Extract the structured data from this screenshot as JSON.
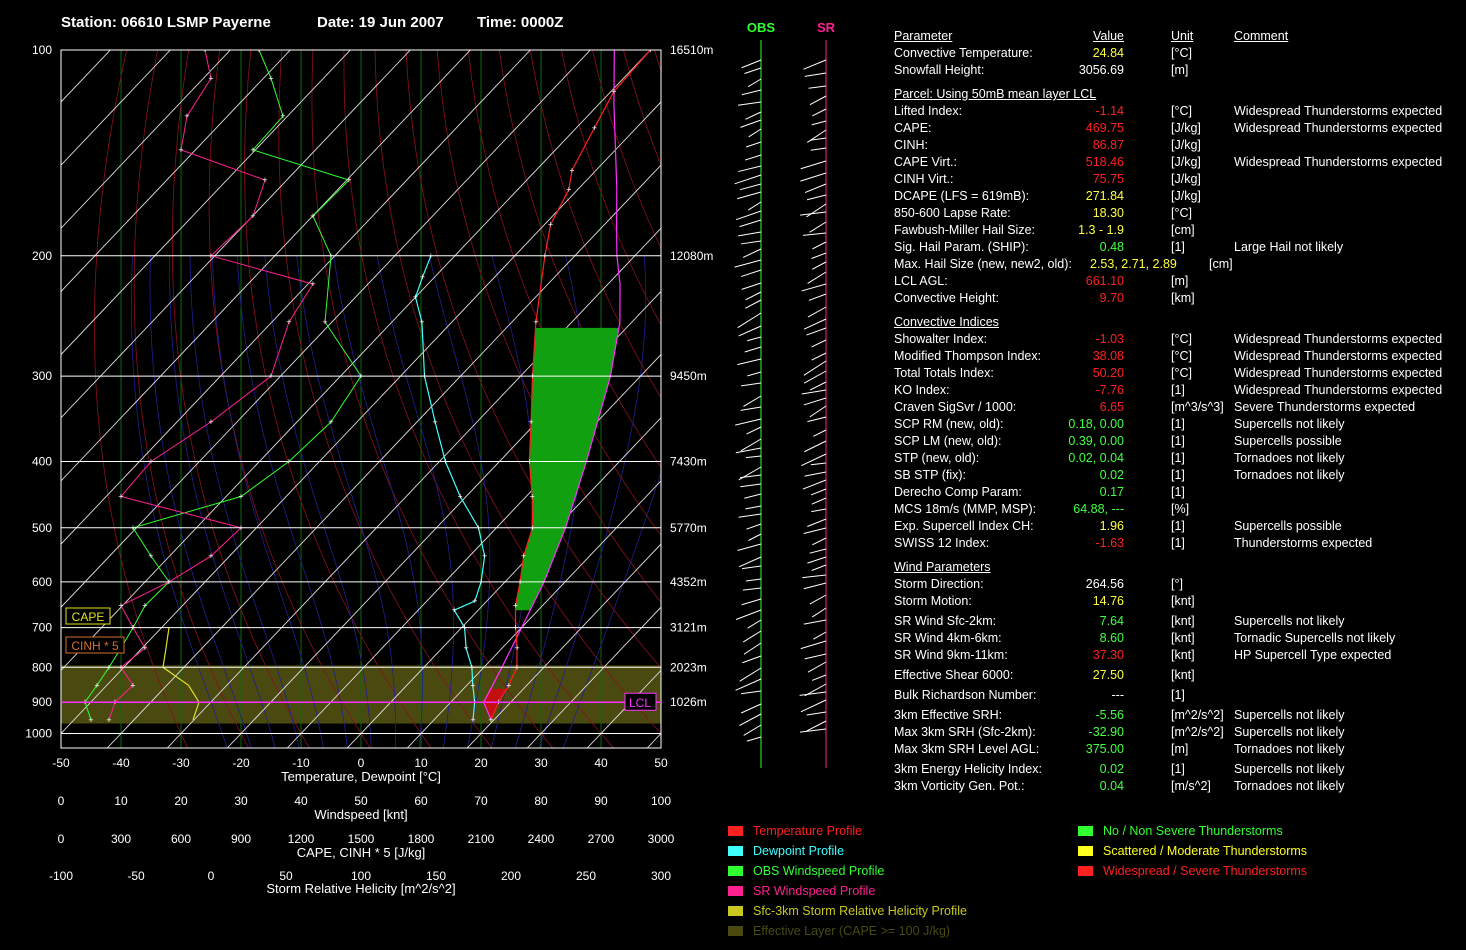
{
  "header": {
    "station": "Station: 06610 LSMP Payerne",
    "date": "Date: 19 Jun 2007",
    "time": "Time: 0000Z"
  },
  "chart_data": {
    "type": "line",
    "title": "Station: 06610 LSMP Payerne   Date: 19 Jun 2007   Time: 0000Z",
    "xlabel": "Temperature, Dewpoint [°C]",
    "ylabel": "",
    "xlim": [
      -50,
      50
    ],
    "ylim": [
      1000,
      100
    ],
    "y_scale": "log-pressure",
    "temperature_ticks": [
      -50,
      -40,
      -30,
      -20,
      -10,
      0,
      10,
      20,
      30,
      40,
      50
    ],
    "pressure_ticks": [
      100,
      200,
      300,
      400,
      500,
      600,
      700,
      800,
      900,
      1000
    ],
    "height_labels": [
      {
        "p": 100,
        "label": "16510m"
      },
      {
        "p": 200,
        "label": "12080m"
      },
      {
        "p": 300,
        "label": "9450m"
      },
      {
        "p": 400,
        "label": "7430m"
      },
      {
        "p": 500,
        "label": "5770m"
      },
      {
        "p": 600,
        "label": "4352m"
      },
      {
        "p": 700,
        "label": "3121m"
      },
      {
        "p": 800,
        "label": "2023m"
      },
      {
        "p": 900,
        "label": "1026m"
      }
    ],
    "series": [
      {
        "name": "Temperature Profile",
        "color": "#ff2020",
        "points": [
          [
            955,
            19.5
          ],
          [
            900,
            18.0
          ],
          [
            850,
            17.0
          ],
          [
            800,
            15.5
          ],
          [
            750,
            12.5
          ],
          [
            700,
            9.0
          ],
          [
            650,
            5.5
          ],
          [
            600,
            2.5
          ],
          [
            550,
            -1.0
          ],
          [
            500,
            -4.0
          ],
          [
            450,
            -9.0
          ],
          [
            400,
            -15.0
          ],
          [
            350,
            -21.0
          ],
          [
            300,
            -28.0
          ],
          [
            250,
            -36.0
          ],
          [
            200,
            -45.0
          ],
          [
            180,
            -49.0
          ],
          [
            160,
            -51.5
          ],
          [
            150,
            -54.0
          ],
          [
            130,
            -57.0
          ],
          [
            115,
            -59.5
          ],
          [
            100,
            -60.0
          ]
        ]
      },
      {
        "name": "Dewpoint Profile",
        "color": "#40ffff",
        "points": [
          [
            955,
            16.5
          ],
          [
            900,
            14.0
          ],
          [
            850,
            11.0
          ],
          [
            800,
            8.0
          ],
          [
            750,
            4.0
          ],
          [
            700,
            0.5
          ],
          [
            660,
            -4.0
          ],
          [
            640,
            -2.0
          ],
          [
            600,
            -4.0
          ],
          [
            550,
            -7.5
          ],
          [
            500,
            -13.0
          ],
          [
            450,
            -21.0
          ],
          [
            400,
            -29.0
          ],
          [
            350,
            -37.0
          ],
          [
            300,
            -46.0
          ],
          [
            250,
            -55.0
          ],
          [
            230,
            -60.0
          ],
          [
            215,
            -62.0
          ],
          [
            200,
            -64.0
          ]
        ]
      },
      {
        "name": "Parcel",
        "color": "#ff30ff",
        "points": [
          [
            955,
            19.5
          ],
          [
            900,
            15.5
          ],
          [
            850,
            14.3
          ],
          [
            800,
            13.0
          ],
          [
            700,
            10.0
          ],
          [
            600,
            6.5
          ],
          [
            500,
            1.5
          ],
          [
            400,
            -5.5
          ],
          [
            300,
            -15.0
          ],
          [
            250,
            -22.0
          ],
          [
            220,
            -28.0
          ],
          [
            200,
            -33.0
          ],
          [
            180,
            -38.0
          ],
          [
            160,
            -43.5
          ],
          [
            140,
            -50.0
          ],
          [
            120,
            -57.5
          ],
          [
            100,
            -66.0
          ]
        ]
      }
    ],
    "obs_windspeed_profile_knots": [
      [
        955,
        5
      ],
      [
        900,
        4
      ],
      [
        850,
        6
      ],
      [
        800,
        8
      ],
      [
        750,
        10
      ],
      [
        700,
        12
      ],
      [
        650,
        14
      ],
      [
        600,
        18
      ],
      [
        550,
        15
      ],
      [
        500,
        12
      ],
      [
        450,
        30
      ],
      [
        400,
        38
      ],
      [
        350,
        45
      ],
      [
        300,
        50
      ],
      [
        250,
        44
      ],
      [
        200,
        45
      ],
      [
        175,
        42
      ],
      [
        155,
        48
      ],
      [
        140,
        32
      ],
      [
        125,
        37
      ],
      [
        110,
        35
      ],
      [
        100,
        33
      ]
    ],
    "sr_windspeed_profile_knots": [
      [
        955,
        8
      ],
      [
        900,
        9
      ],
      [
        850,
        12
      ],
      [
        800,
        10
      ],
      [
        750,
        14
      ],
      [
        700,
        12
      ],
      [
        650,
        10
      ],
      [
        600,
        18
      ],
      [
        550,
        25
      ],
      [
        500,
        30
      ],
      [
        450,
        10
      ],
      [
        400,
        15
      ],
      [
        350,
        25
      ],
      [
        300,
        35
      ],
      [
        250,
        38
      ],
      [
        220,
        42
      ],
      [
        200,
        25
      ],
      [
        175,
        32
      ],
      [
        155,
        34
      ],
      [
        140,
        20
      ],
      [
        125,
        21
      ],
      [
        110,
        25
      ],
      [
        100,
        24
      ]
    ],
    "srh_profile_m2s2": [
      [
        955,
        -12
      ],
      [
        900,
        -8
      ],
      [
        850,
        -15
      ],
      [
        800,
        -32
      ],
      [
        750,
        -30
      ],
      [
        700,
        -28
      ]
    ],
    "effective_layer_hpa": [
      967,
      795
    ],
    "lcl_hpa": 900,
    "axes_below": [
      {
        "label": "Windspeed [knt]",
        "ticks": [
          0,
          10,
          20,
          30,
          40,
          50,
          60,
          70,
          80,
          90,
          100
        ]
      },
      {
        "label": "CAPE, CINH * 5 [J/kg]",
        "ticks": [
          0,
          300,
          600,
          900,
          1200,
          1500,
          1800,
          2100,
          2400,
          2700,
          3000
        ]
      },
      {
        "label": "Storm Relative Helicity [m^2/s^2]",
        "ticks": [
          -100,
          -50,
          0,
          50,
          100,
          150,
          200,
          250,
          300
        ]
      }
    ],
    "side_labels": {
      "cape": "CAPE",
      "cinh": "CINH * 5",
      "lcl": "LCL",
      "obs": "OBS",
      "sr": "SR"
    }
  },
  "params": {
    "headers": {
      "name": "Parameter",
      "value": "Value",
      "unit": "Unit",
      "comment": "Comment"
    },
    "sections": [
      {
        "title": "",
        "rows": [
          {
            "name": "Convective Temperature:",
            "value": "24.84",
            "unit": "[°C]",
            "comment": "",
            "color": "#ffff40"
          },
          {
            "name": "Snowfall Height:",
            "value": "3056.69",
            "unit": "[m]",
            "comment": "",
            "color": "#ffffff"
          }
        ]
      },
      {
        "title": "Parcel: Using 50mB mean layer LCL",
        "rows": [
          {
            "name": "Lifted Index:",
            "value": "-1.14",
            "unit": "[°C]",
            "comment": "Widespread Thunderstorms expected",
            "color": "#ff2020"
          },
          {
            "name": "CAPE:",
            "value": "469.75",
            "unit": "[J/kg]",
            "comment": "Widespread Thunderstorms expected",
            "color": "#ff2020"
          },
          {
            "name": "CINH:",
            "value": "86.87",
            "unit": "[J/kg]",
            "comment": "",
            "color": "#ff2020"
          },
          {
            "name": "CAPE Virt.:",
            "value": "518.46",
            "unit": "[J/kg]",
            "comment": "Widespread Thunderstorms expected",
            "color": "#ff2020"
          },
          {
            "name": "CINH Virt.:",
            "value": "75.75",
            "unit": "[J/kg]",
            "comment": "",
            "color": "#ff2020"
          },
          {
            "name": "DCAPE (LFS = 619mB):",
            "value": "271.84",
            "unit": "[J/kg]",
            "comment": "",
            "color": "#ffff40"
          },
          {
            "name": "850-600 Lapse Rate:",
            "value": "18.30",
            "unit": "[°C]",
            "comment": "",
            "color": "#ffff40"
          },
          {
            "name": "Fawbush-Miller Hail Size:",
            "value": "1.3 - 1.9",
            "unit": "[cm]",
            "comment": "",
            "color": "#ffff40"
          },
          {
            "name": "Sig. Hail Param. (SHIP):",
            "value": "0.48",
            "unit": "[1]",
            "comment": "Large Hail not likely",
            "color": "#40ff40"
          },
          {
            "name": "Max. Hail Size (new, new2, old):",
            "value": "2.53,  2.71,  2.89",
            "unit": "[cm]",
            "comment": "",
            "color": "#ffff40",
            "wide": true
          },
          {
            "name": "LCL AGL:",
            "value": "661.10",
            "unit": "[m]",
            "comment": "",
            "color": "#ff2020"
          },
          {
            "name": "Convective Height:",
            "value": "9.70",
            "unit": "[km]",
            "comment": "",
            "color": "#ff2020"
          }
        ]
      },
      {
        "title": "Convective Indices",
        "rows": [
          {
            "name": "Showalter Index:",
            "value": "-1.03",
            "unit": "[°C]",
            "comment": "Widespread Thunderstorms expected",
            "color": "#ff2020"
          },
          {
            "name": "Modified Thompson Index:",
            "value": "38.08",
            "unit": "[°C]",
            "comment": "Widespread Thunderstorms expected",
            "color": "#ff2020"
          },
          {
            "name": "Total Totals Index:",
            "value": "50.20",
            "unit": "[°C]",
            "comment": "Widespread Thunderstorms expected",
            "color": "#ff2020"
          },
          {
            "name": "KO Index:",
            "value": "-7.76",
            "unit": "[1]",
            "comment": "Widespread Thunderstorms expected",
            "color": "#ff2020"
          },
          {
            "name": "Craven SigSvr / 1000:",
            "value": "6.65",
            "unit": "[m^3/s^3]",
            "comment": "Severe Thunderstorms expected",
            "color": "#ff2020"
          },
          {
            "name": "SCP RM (new, old):",
            "value": "0.18,  0.00",
            "unit": "[1]",
            "comment": "Supercells not likely",
            "color": "#40ff40"
          },
          {
            "name": "SCP LM (new, old):",
            "value": "0.39,  0.00",
            "unit": "[1]",
            "comment": "Supercells possible",
            "color": "#40ff40"
          },
          {
            "name": "STP (new, old):",
            "value": "0.02,  0.04",
            "unit": "[1]",
            "comment": "Tornadoes not likely",
            "color": "#40ff40"
          },
          {
            "name": "SB STP (fix):",
            "value": "0.02",
            "unit": "[1]",
            "comment": "Tornadoes not likely",
            "color": "#40ff40"
          },
          {
            "name": "Derecho Comp Param:",
            "value": "0.17",
            "unit": "[1]",
            "comment": "",
            "color": "#40ff40"
          },
          {
            "name": "MCS 18m/s (MMP, MSP):",
            "value": "64.88,  ---",
            "unit": "[%]",
            "comment": "",
            "color": "#40ff40"
          },
          {
            "name": "Exp. Supercell Index CH:",
            "value": "1.96",
            "unit": "[1]",
            "comment": "Supercells possible",
            "color": "#ffff40"
          },
          {
            "name": "SWISS 12 Index:",
            "value": "-1.63",
            "unit": "[1]",
            "comment": "Thunderstorms expected",
            "color": "#ff2020"
          }
        ]
      },
      {
        "title": "Wind Parameters",
        "rows": [
          {
            "name": "Storm Direction:",
            "value": "264.56",
            "unit": "[°]",
            "comment": "",
            "color": "#ffffff"
          },
          {
            "name": "Storm Motion:",
            "value": "14.76",
            "unit": "[knt]",
            "comment": "",
            "color": "#ffff40"
          },
          {
            "name": "",
            "value": "",
            "unit": "",
            "comment": "",
            "color": "#ffffff",
            "spacer": true
          },
          {
            "name": "SR Wind Sfc-2km:",
            "value": "7.64",
            "unit": "[knt]",
            "comment": "Supercells not likely",
            "color": "#40ff40"
          },
          {
            "name": "SR Wind 4km-6km:",
            "value": "8.60",
            "unit": "[knt]",
            "comment": "Tornadic Supercells not likely",
            "color": "#40ff40"
          },
          {
            "name": "SR Wind 9km-11km:",
            "value": "37.30",
            "unit": "[knt]",
            "comment": "HP Supercell Type expected",
            "color": "#ff2020"
          },
          {
            "name": "",
            "value": "",
            "unit": "",
            "comment": "",
            "color": "#ffffff",
            "spacer": true
          },
          {
            "name": "Effective Shear 6000:",
            "value": "27.50",
            "unit": "[knt]",
            "comment": "",
            "color": "#ffff40"
          },
          {
            "name": "",
            "value": "",
            "unit": "",
            "comment": "",
            "color": "#ffffff",
            "spacer": true
          },
          {
            "name": "Bulk Richardson Number:",
            "value": "---",
            "unit": "[1]",
            "comment": "",
            "color": "#ffffff"
          },
          {
            "name": "",
            "value": "",
            "unit": "",
            "comment": "",
            "color": "#ffffff",
            "spacer": true
          },
          {
            "name": "3km Effective SRH:",
            "value": "-5.56",
            "unit": "[m^2/s^2]",
            "comment": "Supercells not likely",
            "color": "#40ff40"
          },
          {
            "name": "Max 3km SRH (Sfc-2km):",
            "value": "-32.90",
            "unit": "[m^2/s^2]",
            "comment": "Supercells not likely",
            "color": "#40ff40"
          },
          {
            "name": "Max 3km SRH Level AGL:",
            "value": "375.00",
            "unit": "[m]",
            "comment": "Tornadoes not likely",
            "color": "#40ff40"
          },
          {
            "name": "",
            "value": "",
            "unit": "",
            "comment": "",
            "color": "#ffffff",
            "spacer": true
          },
          {
            "name": "3km Energy Helicity Index:",
            "value": "0.02",
            "unit": "[1]",
            "comment": "Supercells not likely",
            "color": "#40ff40"
          },
          {
            "name": "3km Vorticity Gen. Pot.:",
            "value": "0.04",
            "unit": "[m/s^2]",
            "comment": "Tornadoes not likely",
            "color": "#40ff40"
          }
        ]
      }
    ]
  },
  "legend_left": [
    {
      "label": "Temperature Profile",
      "color": "#ff2020"
    },
    {
      "label": "Dewpoint Profile",
      "color": "#40ffff"
    },
    {
      "label": "OBS Windspeed Profile",
      "color": "#30ff30"
    },
    {
      "label": "SR Windspeed Profile",
      "color": "#ff2090"
    },
    {
      "label": "Sfc-3km Storm Relative Helicity Profile",
      "color": "#c8c820"
    },
    {
      "label": "Effective Layer (CAPE >= 100 J/kg)",
      "color": "#4a4a10"
    }
  ],
  "legend_right": [
    {
      "label": "No / Non Severe Thunderstorms",
      "color": "#30ff30"
    },
    {
      "label": "Scattered / Moderate Thunderstorms",
      "color": "#ffff20"
    },
    {
      "label": "Widespread / Severe Thunderstorms",
      "color": "#ff2020"
    }
  ]
}
